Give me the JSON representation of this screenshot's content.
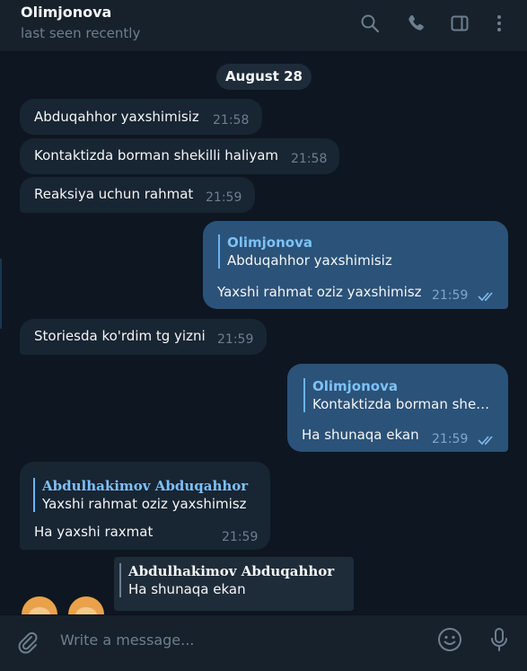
{
  "header": {
    "title": "Olimjonova",
    "status": "last seen recently"
  },
  "icons": {
    "search": "search-icon",
    "call": "phone-icon",
    "sidebar": "sidebar-toggle-icon",
    "more": "more-vertical-icon",
    "attach": "paperclip-icon",
    "emoji": "emoji-icon",
    "voice": "microphone-icon"
  },
  "colors": {
    "background": "#0e1621",
    "header": "#17212b",
    "incoming_bubble": "#182533",
    "outgoing_bubble": "#2b5278",
    "accent": "#6ab2f2"
  },
  "chat": {
    "date_separator": "August 28",
    "messages": [
      {
        "direction": "incoming",
        "text": "Abduqahhor yaxshimisiz",
        "time": "21:58"
      },
      {
        "direction": "incoming",
        "text": "Kontaktizda borman shekilli haliyam",
        "time": "21:58"
      },
      {
        "direction": "incoming",
        "text": "Reaksiya uchun rahmat",
        "time": "21:59"
      },
      {
        "direction": "outgoing",
        "reply_name": "Olimjonova",
        "reply_text": "Abduqahhor yaxshimisiz",
        "text": "Yaxshi rahmat oziz yaxshimisz",
        "time": "21:59",
        "read": true
      },
      {
        "direction": "incoming",
        "text": "Storiesda ko'rdim tg yizni",
        "time": "21:59"
      },
      {
        "direction": "outgoing",
        "reply_name": "Olimjonova",
        "reply_text": "Kontaktizda borman she…",
        "text": "Ha shunaqa ekan",
        "time": "21:59",
        "read": true
      },
      {
        "direction": "incoming",
        "reply_name": "Abdulhakimov Abduqahhor",
        "reply_text": "Yaxshi rahmat oziz yaxshimisz",
        "text": "Ha yaxshi raxmat",
        "time": "21:59"
      }
    ],
    "partial_quote": {
      "name": "Abdulhakimov Abduqahhor",
      "text": "Ha shunaqa ekan"
    }
  },
  "composer": {
    "placeholder": "Write a message..."
  }
}
